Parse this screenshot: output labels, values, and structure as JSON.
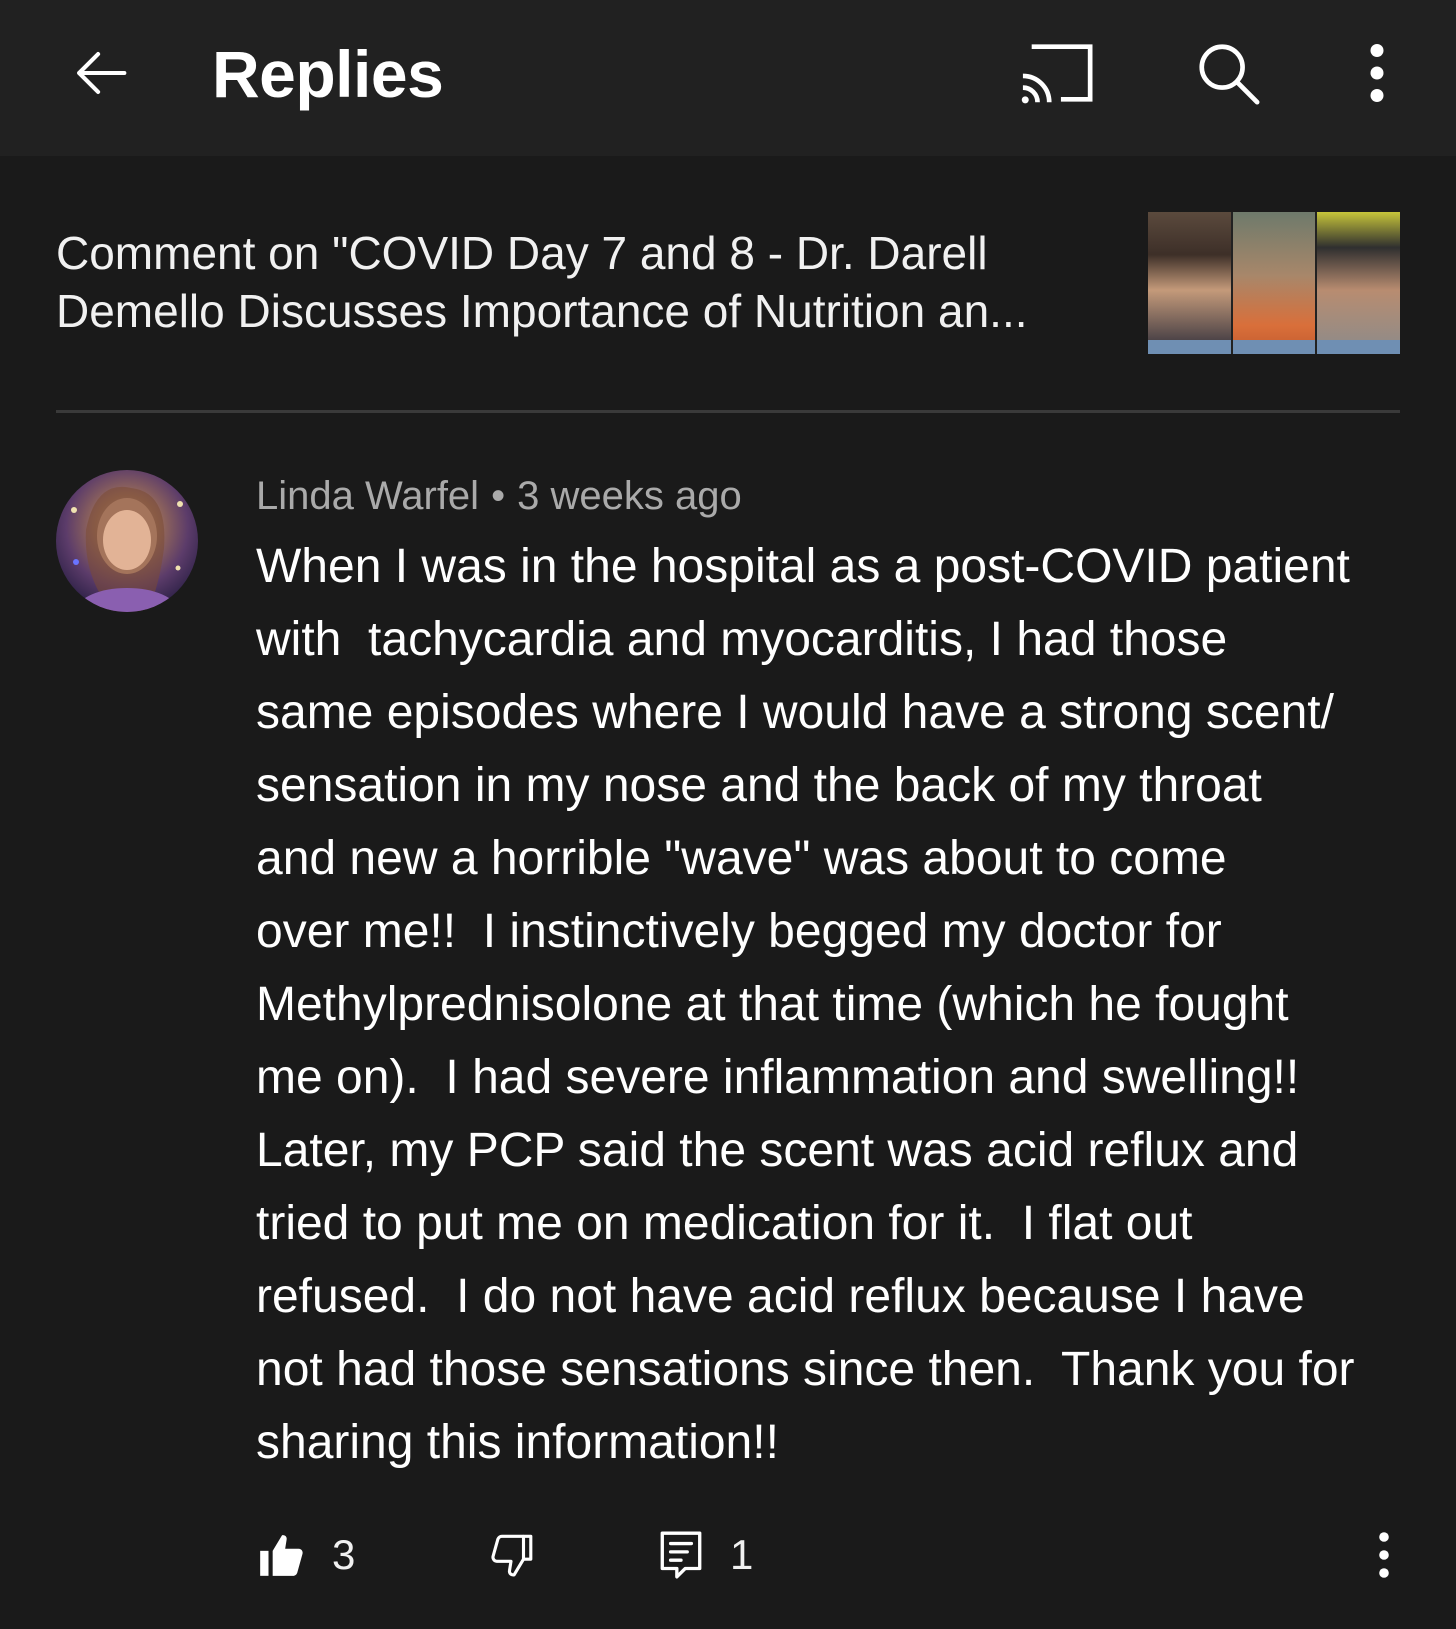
{
  "header": {
    "title": "Replies"
  },
  "video_context": {
    "label": "Comment on \"COVID Day 7 and 8 - Dr. Darell Demello Discusses Importance of Nutrition an..."
  },
  "comment": {
    "author": "Linda Warfel",
    "separator": "•",
    "time": "3 weeks ago",
    "lines": [
      "When I was in the hospital as a post-COVID patient",
      "with  tachycardia and myocarditis, I had those",
      "same episodes where I would have a strong scent/",
      "sensation in my nose and the back of my throat",
      "and new a horrible \"wave\" was about to come",
      "over me!!  I instinctively begged my doctor for",
      "Methylprednisolone at that time (which he fought",
      "me on).  I had severe inflammation and swelling!!",
      "Later, my PCP said the scent was acid reflux and",
      "tried to put me on medication for it.  I flat out",
      "refused.  I do not have acid reflux because I have",
      "not had those sensations since then.  Thank you for",
      "sharing this information!!"
    ],
    "like_count": "3",
    "reply_count": "1"
  },
  "icons": {
    "back": "arrow-left-icon",
    "cast": "cast-icon",
    "search": "search-icon",
    "more": "more-vert-icon",
    "like": "thumb-up-icon",
    "dislike": "thumb-down-icon",
    "reply": "reply-icon"
  },
  "colors": {
    "background": "#1a1a1a",
    "topbar": "#212121",
    "text_primary": "#ffffff",
    "text_secondary": "#aaaaaa",
    "divider": "#3a3a3a"
  }
}
